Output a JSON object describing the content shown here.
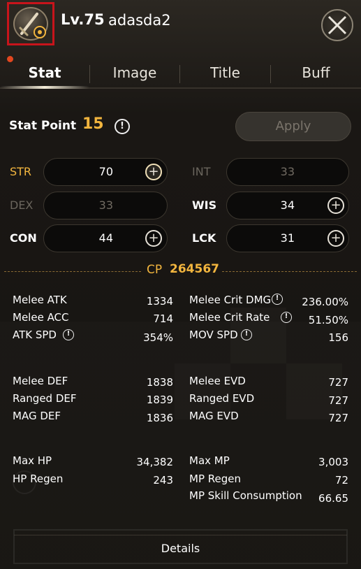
{
  "header": {
    "level_prefix": "Lv.",
    "level": "75",
    "character_name": "adasda2"
  },
  "tabs": [
    {
      "label": "Stat",
      "active": true
    },
    {
      "label": "Image",
      "active": false
    },
    {
      "label": "Title",
      "active": false
    },
    {
      "label": "Buff",
      "active": false
    }
  ],
  "stat_point": {
    "label": "Stat Point",
    "value": "15"
  },
  "apply_label": "Apply",
  "stats": {
    "str": {
      "label": "STR",
      "value": "70"
    },
    "int": {
      "label": "INT",
      "value": "33"
    },
    "dex": {
      "label": "DEX",
      "value": "33"
    },
    "wis": {
      "label": "WIS",
      "value": "34"
    },
    "con": {
      "label": "CON",
      "value": "44"
    },
    "lck": {
      "label": "LCK",
      "value": "31"
    }
  },
  "cp": {
    "label": "CP",
    "value": "264567"
  },
  "details": {
    "left_1": [
      {
        "label": "Melee ATK",
        "value": "1334"
      },
      {
        "label": "Melee ACC",
        "value": "714"
      },
      {
        "label": "ATK SPD",
        "value": "354%"
      }
    ],
    "right_1": [
      {
        "label": "Melee Crit DMG",
        "value": "236.00%"
      },
      {
        "label": "Melee Crit Rate",
        "value": "51.50%"
      },
      {
        "label": "MOV SPD",
        "value": "156"
      }
    ],
    "left_2": [
      {
        "label": "Melee DEF",
        "value": "1838"
      },
      {
        "label": "Ranged DEF",
        "value": "1839"
      },
      {
        "label": "MAG DEF",
        "value": "1836"
      }
    ],
    "right_2": [
      {
        "label": "Melee EVD",
        "value": "727"
      },
      {
        "label": "Ranged EVD",
        "value": "727"
      },
      {
        "label": "MAG EVD",
        "value": "727"
      }
    ],
    "left_3": [
      {
        "label": "Max HP",
        "value": "34,382"
      },
      {
        "label": "HP Regen",
        "value": "243"
      }
    ],
    "right_3": [
      {
        "label": "Max MP",
        "value": "3,003"
      },
      {
        "label": "MP Regen",
        "value": "72"
      },
      {
        "label": "MP Skill Consumption",
        "value": "66.65"
      }
    ]
  },
  "details_button": "Details",
  "colors": {
    "accent_gold": "#f2b53e",
    "highlight_red": "#c8141b",
    "notification": "#e2471f"
  },
  "icons": {
    "avatar": "sword-emblem-icon",
    "close": "close-x-icon",
    "info": "info-icon",
    "plus": "plus-icon"
  }
}
